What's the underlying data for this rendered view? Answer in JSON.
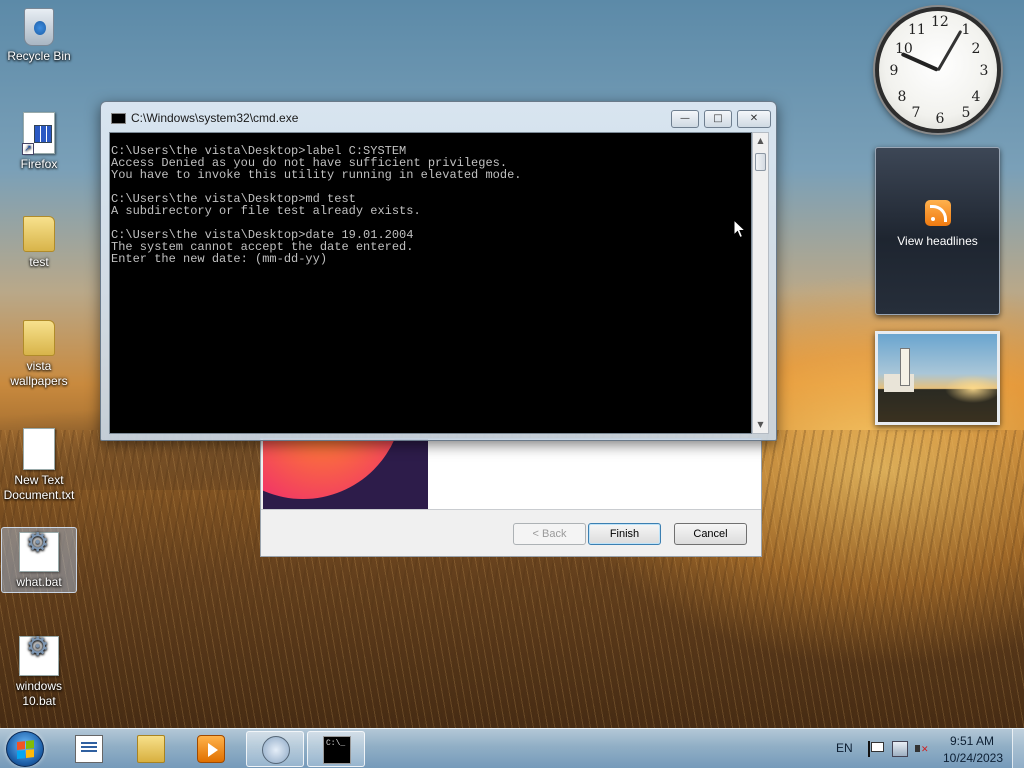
{
  "desktop": {
    "icons": [
      {
        "label": "Recycle Bin"
      },
      {
        "label": "Firefox"
      },
      {
        "label": "test"
      },
      {
        "label": "vista wallpapers"
      },
      {
        "label": "New Text Document.txt"
      },
      {
        "label": "what.bat"
      },
      {
        "label": "windows 10.bat"
      }
    ]
  },
  "gadgets": {
    "clock": {
      "numbers": [
        "12",
        "1",
        "2",
        "3",
        "4",
        "5",
        "6",
        "7",
        "8",
        "9",
        "10",
        "11"
      ]
    },
    "rss": {
      "label": "View headlines"
    }
  },
  "installer": {
    "back_label": "< Back",
    "finish_label": "Finish",
    "cancel_label": "Cancel"
  },
  "cmd_window": {
    "title": "C:\\Windows\\system32\\cmd.exe",
    "minimize_symbol": "—",
    "maximize_symbol": "□",
    "close_symbol": "✕",
    "lines": [
      "C:\\Users\\the vista\\Desktop>label C:SYSTEM",
      "Access Denied as you do not have sufficient privileges.",
      "You have to invoke this utility running in elevated mode.",
      "",
      "C:\\Users\\the vista\\Desktop>md test",
      "A subdirectory or file test already exists.",
      "",
      "C:\\Users\\the vista\\Desktop>date 19.01.2004",
      "The system cannot accept the date entered.",
      "Enter the new date: (mm-dd-yy)"
    ]
  },
  "taskbar": {
    "cmd_icon_text": "C:\\_",
    "language": "EN",
    "time": "9:51 AM",
    "date": "10/24/2023"
  }
}
